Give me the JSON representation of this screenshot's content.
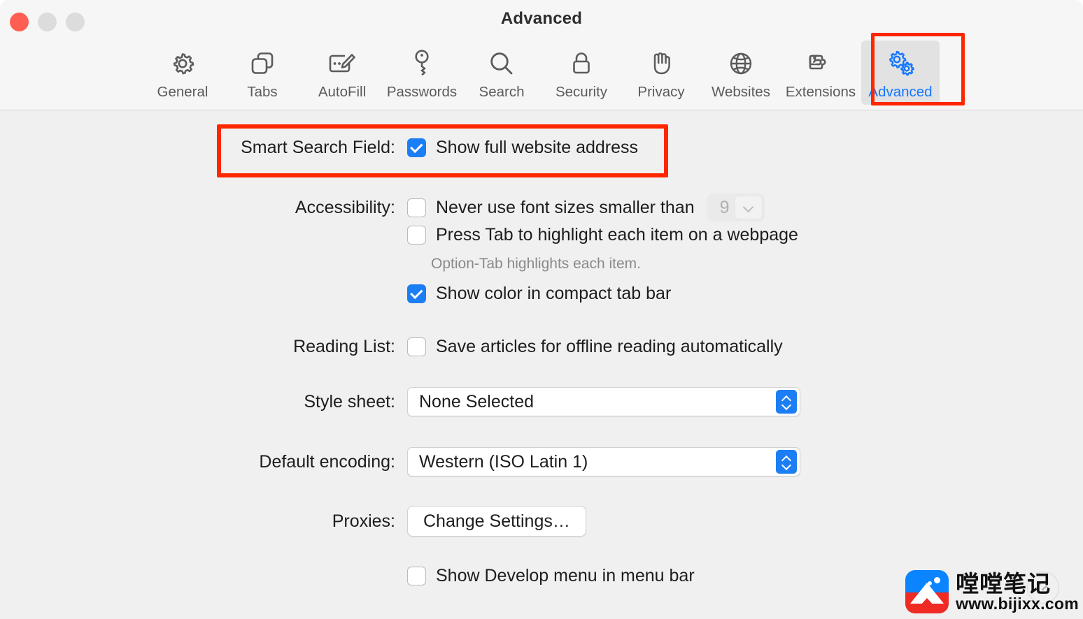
{
  "window": {
    "title": "Advanced",
    "traffic_lights": [
      "close",
      "minimize",
      "zoom"
    ]
  },
  "toolbar": {
    "items": [
      {
        "label": "General",
        "icon": "gear-icon",
        "selected": false
      },
      {
        "label": "Tabs",
        "icon": "tabs-icon",
        "selected": false
      },
      {
        "label": "AutoFill",
        "icon": "autofill-icon",
        "selected": false
      },
      {
        "label": "Passwords",
        "icon": "key-icon",
        "selected": false
      },
      {
        "label": "Search",
        "icon": "search-icon",
        "selected": false
      },
      {
        "label": "Security",
        "icon": "lock-icon",
        "selected": false
      },
      {
        "label": "Privacy",
        "icon": "hand-icon",
        "selected": false
      },
      {
        "label": "Websites",
        "icon": "globe-icon",
        "selected": false
      },
      {
        "label": "Extensions",
        "icon": "puzzle-icon",
        "selected": false
      },
      {
        "label": "Advanced",
        "icon": "gears-icon",
        "selected": true
      }
    ],
    "selected_label": "Advanced",
    "selected_accent": "#1677ff"
  },
  "annotations": {
    "color": "#ff2600",
    "boxes": [
      "advanced-tab",
      "smart-search-field-row"
    ]
  },
  "main": {
    "smart_search": {
      "label": "Smart Search Field:",
      "checkbox_label": "Show full website address",
      "checked": true
    },
    "accessibility": {
      "label": "Accessibility:",
      "font_size_label": "Never use font sizes smaller than",
      "font_size_checked": false,
      "font_size_value": "9",
      "tab_highlight_label": "Press Tab to highlight each item on a webpage",
      "tab_highlight_checked": false,
      "hint": "Option-Tab highlights each item.",
      "compact_tab_label": "Show color in compact tab bar",
      "compact_tab_checked": true
    },
    "reading_list": {
      "label": "Reading List:",
      "checkbox_label": "Save articles for offline reading automatically",
      "checked": false
    },
    "style_sheet": {
      "label": "Style sheet:",
      "value": "None Selected"
    },
    "default_encoding": {
      "label": "Default encoding:",
      "value": "Western (ISO Latin 1)"
    },
    "proxies": {
      "label": "Proxies:",
      "button_label": "Change Settings…"
    },
    "develop_menu": {
      "checkbox_label": "Show Develop menu in menu bar",
      "checked": false
    },
    "help_button": "?"
  },
  "watermark": {
    "name": "嘡嘡笔记",
    "url": "www.bijixx.com"
  }
}
